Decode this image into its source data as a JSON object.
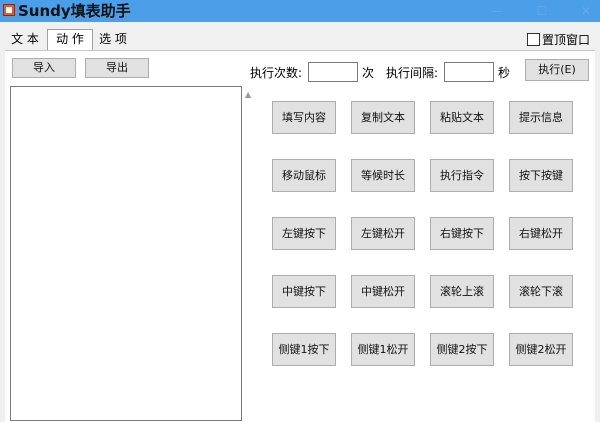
{
  "window": {
    "title": "Sundy填表助手"
  },
  "tabs": [
    {
      "label": "文 本"
    },
    {
      "label": "动 作"
    },
    {
      "label": "选 项"
    }
  ],
  "pin_top_label": "置顶窗口",
  "import_label": "导入",
  "export_label": "导出",
  "exec_count_label": "执行次数:",
  "exec_count_value": "",
  "count_unit": "次",
  "interval_label": "执行间隔:",
  "interval_value": "",
  "interval_unit": "秒",
  "execute_label": "执行(E)",
  "actions": [
    "填写内容",
    "复制文本",
    "粘贴文本",
    "提示信息",
    "移动鼠标",
    "等候时长",
    "执行指令",
    "按下按键",
    "左键按下",
    "左键松开",
    "右键按下",
    "右键松开",
    "中键按下",
    "中键松开",
    "滚轮上滚",
    "滚轮下滚",
    "侧键1按下",
    "侧键1松开",
    "侧键2按下",
    "侧键2松开"
  ],
  "colors": {
    "titlebar": "#4a9fe8",
    "button_face": "#e1e1e1"
  }
}
